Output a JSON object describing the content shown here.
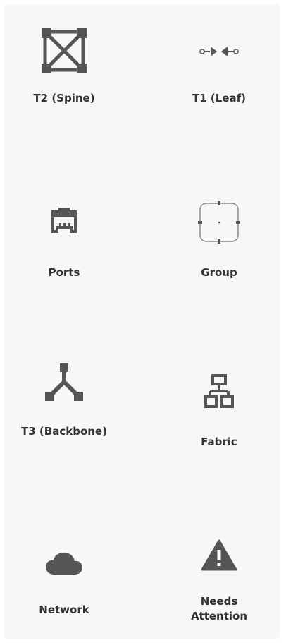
{
  "palette": {
    "items": [
      {
        "label": "T2 (Spine)",
        "icon": "spine-switch-icon"
      },
      {
        "label": "T1 (Leaf)",
        "icon": "leaf-switch-icon"
      },
      {
        "label": "Ports",
        "icon": "port-icon"
      },
      {
        "label": "Group",
        "icon": "group-icon"
      },
      {
        "label": "T3 (Backbone)",
        "icon": "backbone-icon"
      },
      {
        "label": "Fabric",
        "icon": "fabric-icon"
      },
      {
        "label": "Network",
        "icon": "cloud-icon"
      },
      {
        "label": "Needs Attention",
        "icon": "warning-icon"
      }
    ],
    "colors": {
      "icon": "#555555",
      "text": "#333333",
      "background": "#f7f7f7"
    }
  }
}
